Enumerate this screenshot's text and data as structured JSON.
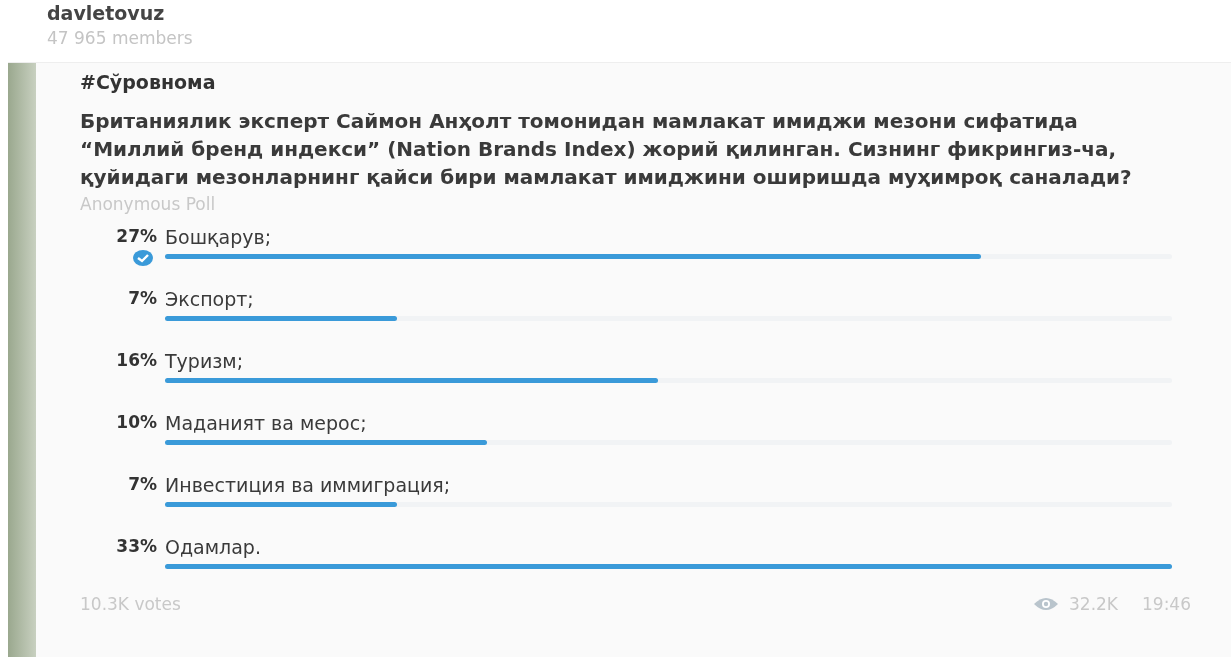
{
  "channel": {
    "name": "davletovuz",
    "members": "47 965 members"
  },
  "post": {
    "hashtag": "#Сўровнома",
    "question": "Британиялик эксперт Саймон Анҳолт томонидан мамлакат имиджи мезони сифатида “Миллий бренд индекси” (Nation Brands Index) жорий қилинган.   Сизнинг фикрингиз-ча, қуйидаги мезонларнинг қайси бири мамлакат имиджини оширишда муҳимроқ саналади?",
    "poll_type": "Anonymous Poll",
    "options": [
      {
        "percent": "27%",
        "label": "Бошқарув;",
        "level": 0.81,
        "selected": true
      },
      {
        "percent": "7%",
        "label": "Экспорт;",
        "level": 0.23,
        "selected": false
      },
      {
        "percent": "16%",
        "label": "Туризм;",
        "level": 0.49,
        "selected": false
      },
      {
        "percent": "10%",
        "label": "Маданият ва мерос;",
        "level": 0.32,
        "selected": false
      },
      {
        "percent": "7%",
        "label": "Инвестиция ва иммиграция;",
        "level": 0.23,
        "selected": false
      },
      {
        "percent": "33%",
        "label": "Одамлар.",
        "level": 1.0,
        "selected": false
      }
    ],
    "votes": "10.3K votes",
    "views": "32.2K",
    "time": "19:46"
  }
}
